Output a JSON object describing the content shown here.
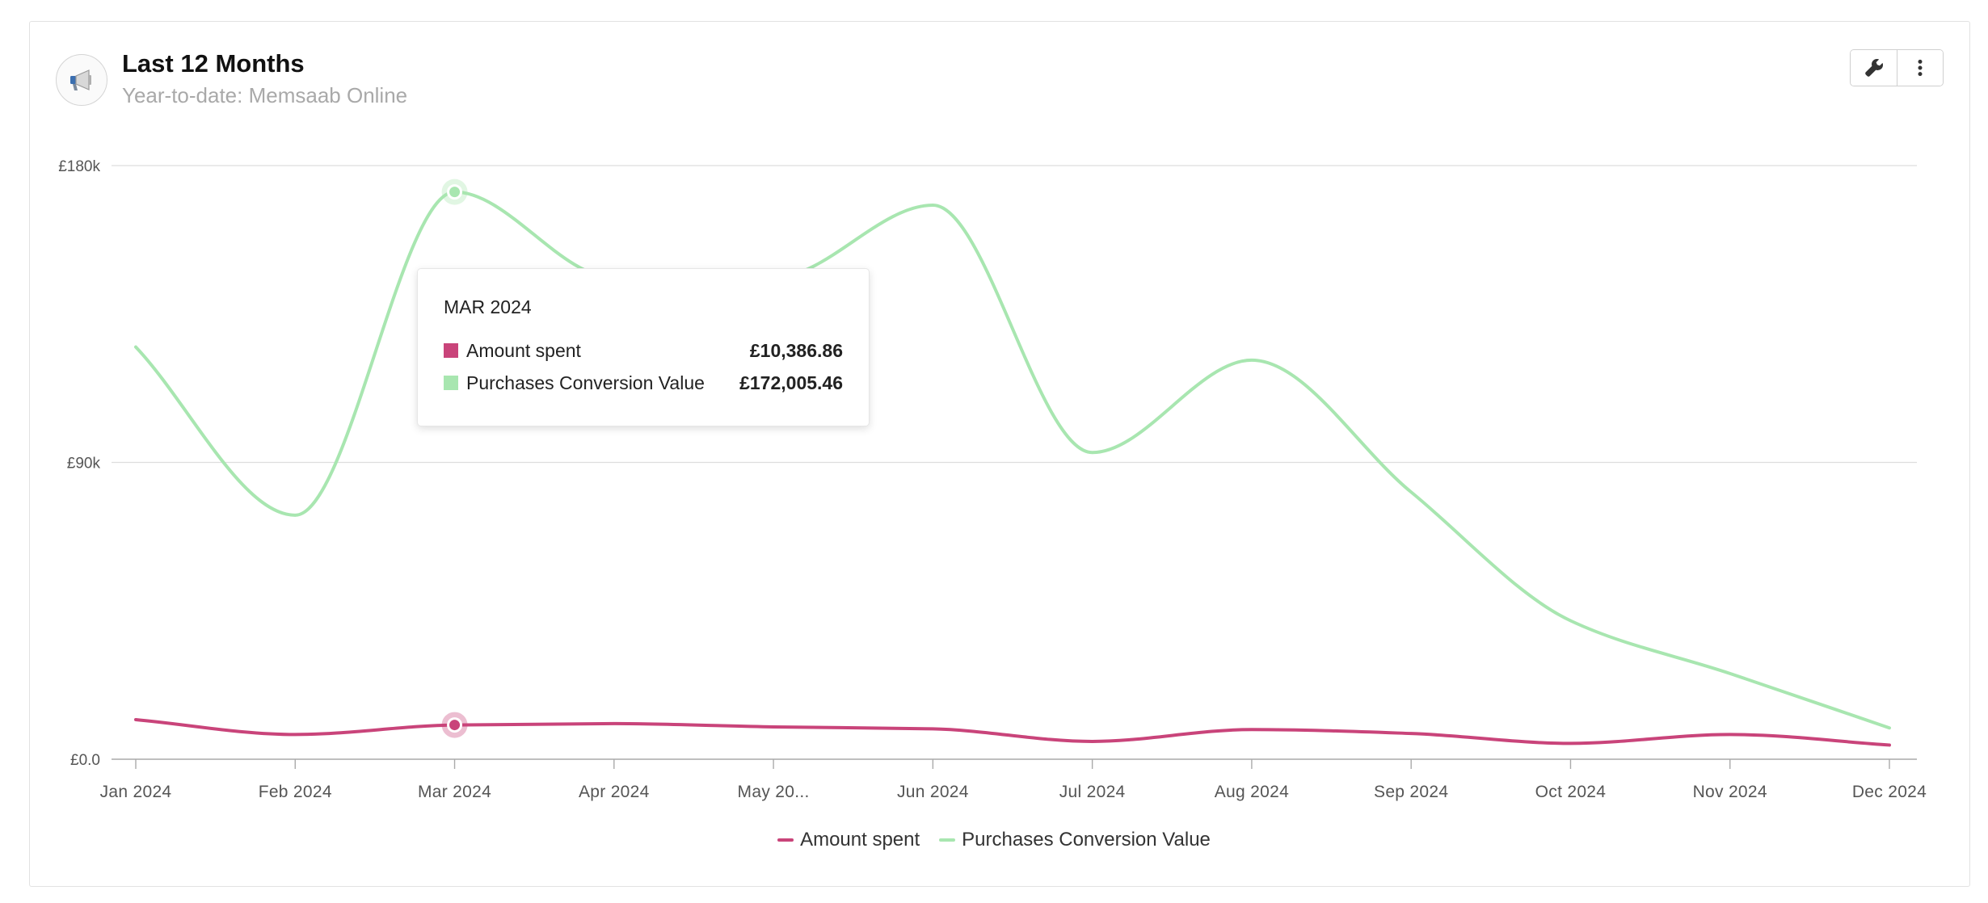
{
  "header": {
    "title": "Last 12 Months",
    "subtitle": "Year-to-date: Memsaab Online",
    "avatar_icon": "megaphone-icon"
  },
  "toolbar": {
    "settings_icon": "wrench-icon",
    "menu_icon": "more-vertical-icon"
  },
  "tooltip": {
    "period": "MAR 2024",
    "rows": [
      {
        "label": "Amount spent",
        "value": "£10,386.86",
        "color": "#c9447a"
      },
      {
        "label": "Purchases Conversion Value",
        "value": "£172,005.46",
        "color": "#a8e6b0"
      }
    ]
  },
  "colors": {
    "amount_spent": "#c9447a",
    "purchases_conversion_value": "#a8e6b0",
    "grid": "#dddddd",
    "axis": "#aaaaaa"
  },
  "chart_data": {
    "type": "line",
    "x": [
      "Jan 2024",
      "Feb 2024",
      "Mar 2024",
      "Apr 2024",
      "May 20...",
      "Jun 2024",
      "Jul 2024",
      "Aug 2024",
      "Sep 2024",
      "Oct 2024",
      "Nov 2024",
      "Dec 2024"
    ],
    "series": [
      {
        "name": "Amount spent",
        "color": "#c9447a",
        "values": [
          12000,
          7500,
          10386.86,
          10800,
          9800,
          9200,
          5400,
          9000,
          7800,
          4800,
          7500,
          4300
        ]
      },
      {
        "name": "Purchases Conversion Value",
        "color": "#a8e6b0",
        "values": [
          125000,
          74000,
          172005.46,
          146000,
          146000,
          168000,
          93000,
          121000,
          81000,
          42000,
          26000,
          9500
        ]
      }
    ],
    "y_ticks": [
      "£0.0",
      "£90k",
      "£180k"
    ],
    "ylim": [
      0,
      180000
    ],
    "highlight_index": 2,
    "grid": true,
    "legend_position": "bottom-center"
  },
  "legend": [
    {
      "label": "Amount spent",
      "color": "#c9447a"
    },
    {
      "label": "Purchases Conversion Value",
      "color": "#a8e6b0"
    }
  ]
}
